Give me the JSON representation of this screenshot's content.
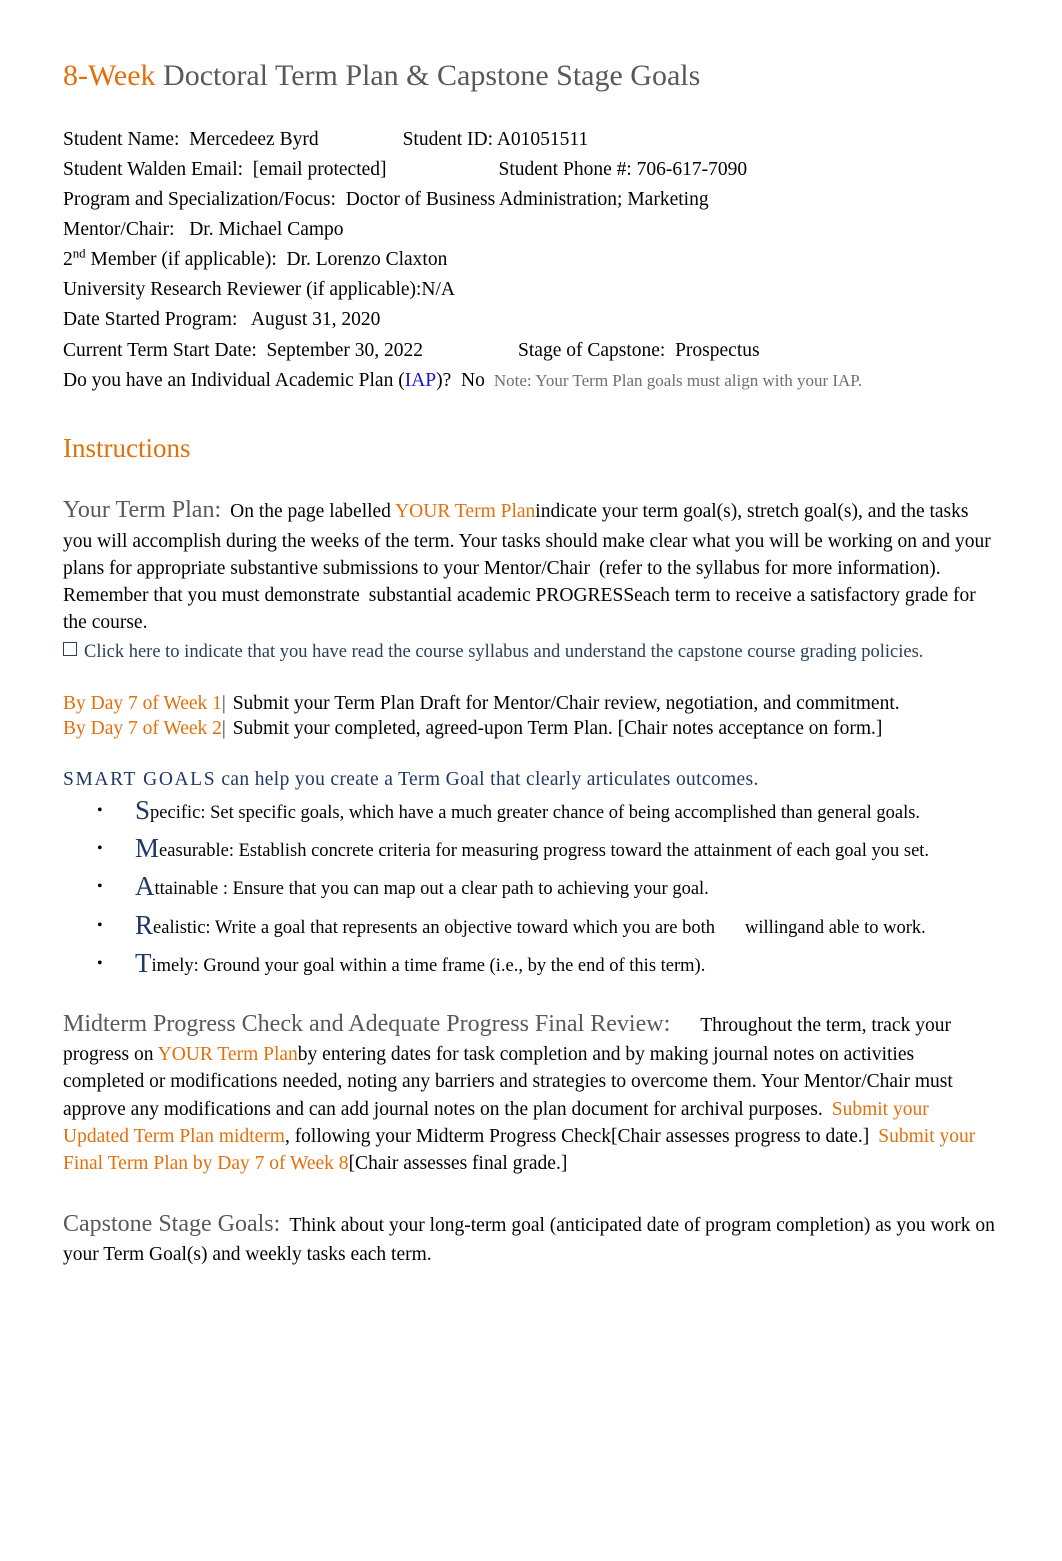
{
  "document": {
    "title_accent": "8-Week",
    "title_rest": " Doctoral Term Plan & Capstone Stage Goals"
  },
  "student_info": {
    "name_label": "Student Name:  Mercedeez Byrd",
    "id_label": "Student ID: A01051511",
    "email_label": "Student Walden Email:  [email protected]",
    "phone_label": "Student Phone #: 706-617-7090",
    "program_label": "Program and Specialization/Focus:  Doctor of Business Administration; Marketing",
    "mentor_label": "Mentor/Chair:   Dr. Michael Campo",
    "second_member_prefix": "2",
    "second_member_sup": "nd",
    "second_member_label": " Member (if applicable):  Dr. Lorenzo Claxton",
    "reviewer_label": "University Research Reviewer (if applicable):N/A",
    "date_started_label": "Date Started Program:   August 31, 2020",
    "term_start_label": "Current Term Start Date:  September 30, 2022",
    "stage_label": "Stage of Capstone:  Prospectus",
    "iap_question_prefix": "Do you have an Individual Academic Plan (",
    "iap_link": "IAP",
    "iap_question_suffix": ")?  No",
    "iap_note": "Note: Your Term Plan goals must align with your IAP."
  },
  "instructions": {
    "heading": "Instructions",
    "term_plan_heading": "Your Term Plan:",
    "term_plan_text_1": "On the page labelled ",
    "term_plan_link": "YOUR Term Plan",
    "term_plan_text_2": "indicate your term goal(s), stretch goal(s), and the tasks you will accomplish during the weeks of the term. Your tasks should make clear what you will be working on and your plans for appropriate substantive submissions to your Mentor/Chair",
    "term_plan_text_3": "(refer to the syllabus for more information). Remember that you must demonstrate",
    "term_plan_text_4": "substantial academic PROGRESS",
    "term_plan_text_5": "each term to receive a satisfactory grade for the course.",
    "syllabus_checkbox_label": "Click here to indicate that you have read the course syllabus and understand the capstone course grading policies."
  },
  "deadlines": [
    {
      "accent": "By Day 7 of Week 1",
      "separator": "|",
      "text": " Submit your Term Plan Draft for Mentor/Chair review, negotiation, and commitment."
    },
    {
      "accent": "By Day 7 of Week 2",
      "separator": "|",
      "text": " Submit your completed, agreed-upon Term Plan. [Chair notes acceptance on form.]"
    }
  ],
  "smart_goals": {
    "intro_accent": "SMART GOALS",
    "intro_rest": " can help you create a Term Goal that clearly articulates outcomes.",
    "items": [
      {
        "initial": "S",
        "text": "pecific: Set specific goals, which have a much greater chance of being accomplished than general goals."
      },
      {
        "initial": "M",
        "text": "easurable:  Establish concrete criteria for measuring progress toward the attainment of each goal you set."
      },
      {
        "initial": "A",
        "text": "ttainable : Ensure that you can map out a clear path to achieving your goal."
      },
      {
        "initial": "R",
        "text": "ealistic: Write a goal that represents an objective toward which you are both"
      },
      {
        "initial": "T",
        "text": "imely: Ground your goal within a time frame (i.e., by the end of this term)."
      }
    ],
    "realistic_tail_1": "willing",
    "realistic_tail_2": "and  able to work."
  },
  "midterm": {
    "heading": "Midterm Progress Check and Adequate Progress Final Review:",
    "text_1": "Throughout the term, track your progress on ",
    "link_1": "YOUR Term Plan",
    "text_2": "by entering dates for task completion and by making journal notes on activities completed or modifications needed, noting any barriers and strategies to overcome them. Your Mentor/Chair must approve any modifications and can add journal notes on the plan document for archival purposes.",
    "link_2": "Submit your Updated Term Plan midterm",
    "text_3": ", following your Midterm Progress Check",
    "text_4": "[Chair assesses progress to date.]",
    "link_3": "Submit your Final Term Plan by Day 7 of Week 8",
    "text_5": "[Chair assesses final grade.]"
  },
  "capstone": {
    "heading": "Capstone Stage Goals:",
    "text": "Think about your long-term goal (anticipated date of program completion) as you work on your Term Goal(s) and weekly tasks each term."
  },
  "colors": {
    "accent_orange": "#E2700B",
    "heading_gray": "#595959",
    "link_blue": "#1313CE",
    "smart_navy": "#1F3864",
    "checkbox_slate": "#2B4059"
  }
}
